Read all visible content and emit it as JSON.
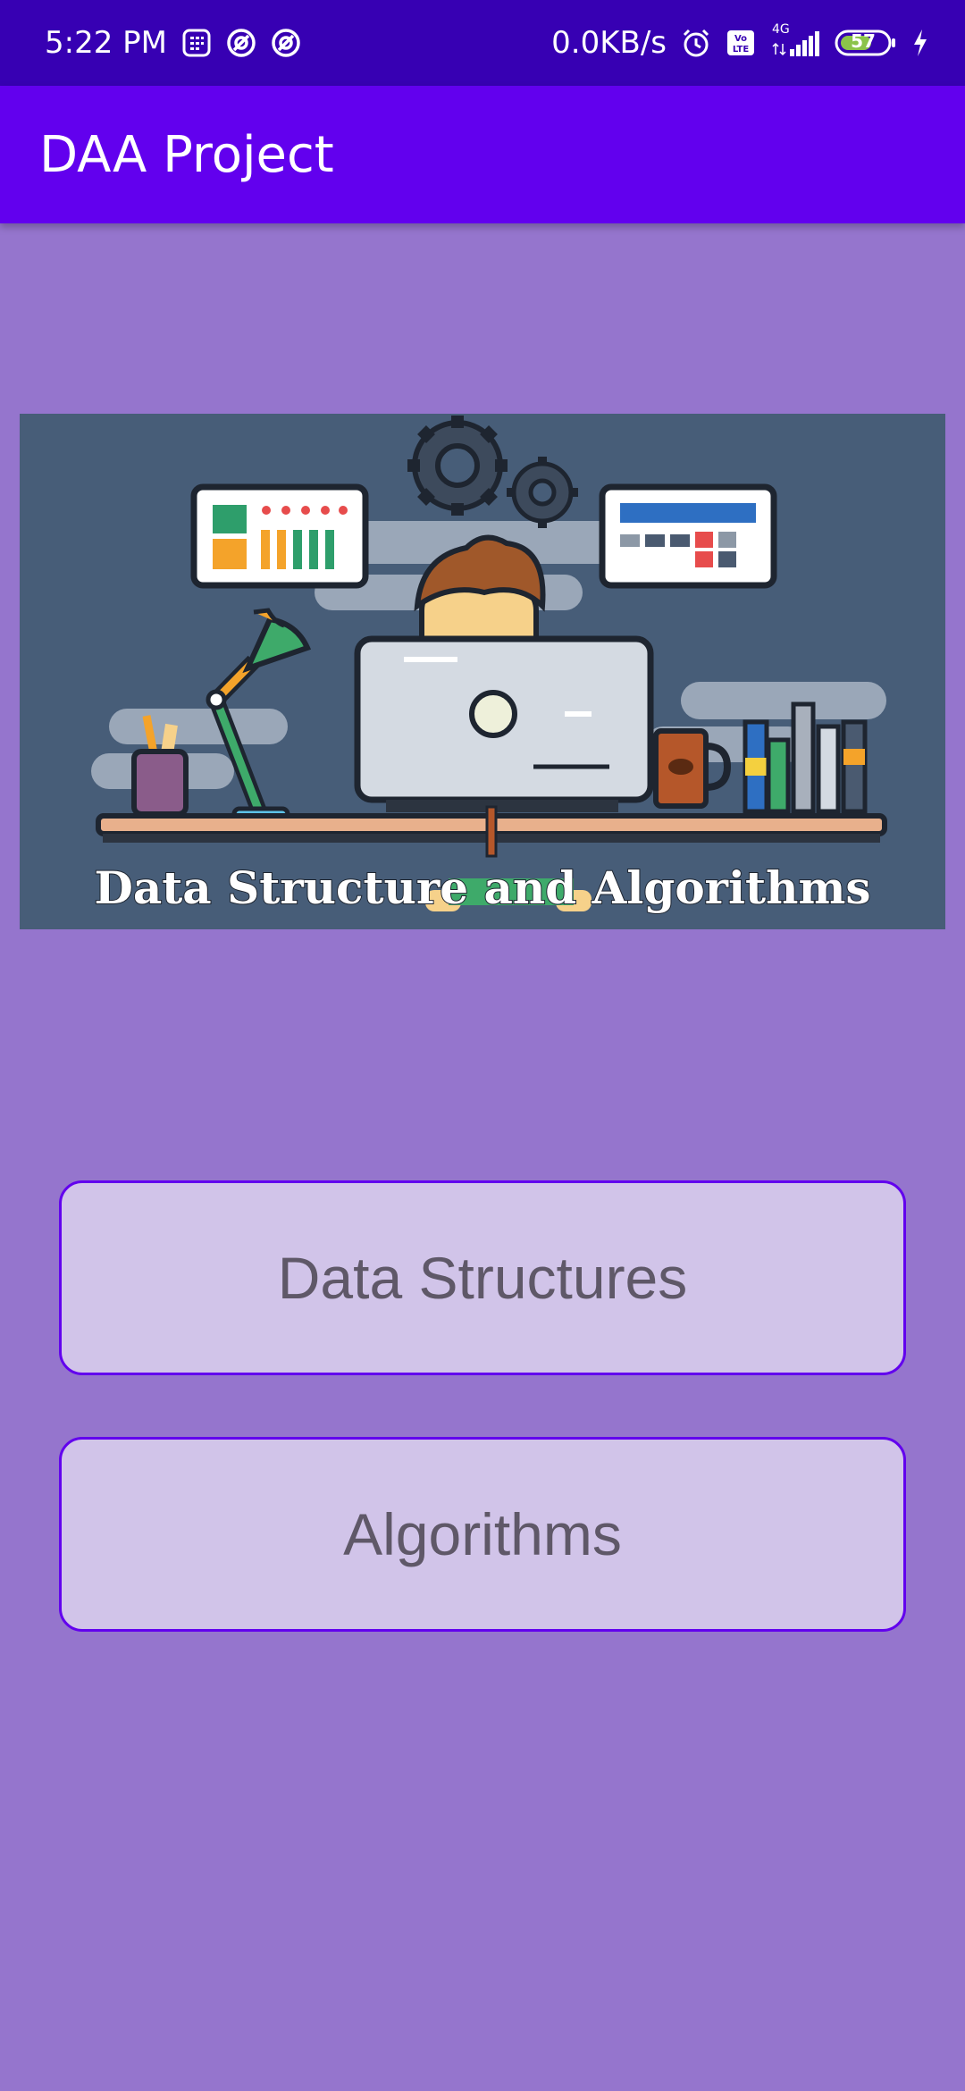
{
  "status_bar": {
    "time": "5:22 PM",
    "net_speed": "0.0KB/s",
    "network_type": "4G",
    "volte_label": "Vo LTE",
    "battery": "57",
    "icons": [
      "calculator-icon",
      "notification-icon",
      "notification-icon",
      "alarm-icon",
      "volte-icon",
      "signal-icon",
      "battery-icon",
      "charging-icon"
    ]
  },
  "app_bar": {
    "title": "DAA Project"
  },
  "banner": {
    "caption": "Data Structure and Algorithms"
  },
  "buttons": {
    "data_structures": "Data Structures",
    "algorithms": "Algorithms"
  },
  "colors": {
    "status_bar": "#3700B3",
    "app_bar": "#6200EE",
    "background": "#9575CD",
    "button_fill": "#D1C4E9",
    "button_border": "#6200EE"
  }
}
